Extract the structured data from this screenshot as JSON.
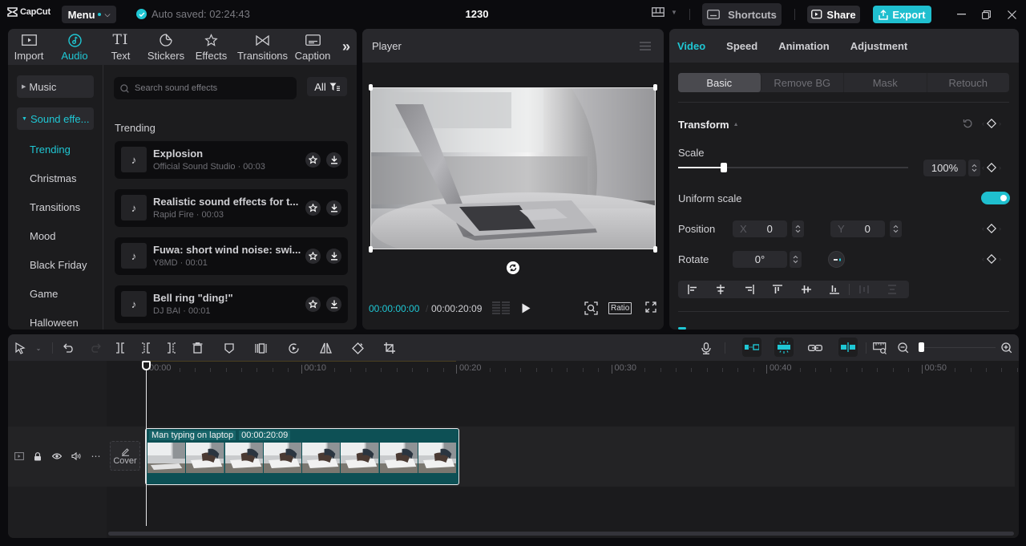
{
  "app": {
    "brand": "CapCut",
    "menu_label": "Menu",
    "autosave_text": "Auto saved: 02:24:43",
    "project_title": "1230",
    "shortcuts_label": "Shortcuts",
    "share_label": "Share",
    "export_label": "Export",
    "accent_color": "#1fc7d4"
  },
  "media": {
    "tabs": [
      {
        "label": "Import",
        "icon": "import-icon",
        "active": false
      },
      {
        "label": "Audio",
        "icon": "audio-icon",
        "active": true
      },
      {
        "label": "Text",
        "icon": "text-icon",
        "active": false
      },
      {
        "label": "Stickers",
        "icon": "stickers-icon",
        "active": false
      },
      {
        "label": "Effects",
        "icon": "effects-icon",
        "active": false
      },
      {
        "label": "Transitions",
        "icon": "transitions-icon",
        "active": false
      },
      {
        "label": "Caption",
        "icon": "caption-icon",
        "active": false
      }
    ],
    "categories": [
      {
        "label": "Music",
        "open": false
      },
      {
        "label": "Sound effe...",
        "open": true
      }
    ],
    "subcategories": [
      {
        "label": "Trending",
        "active": true
      },
      {
        "label": "Christmas",
        "active": false
      },
      {
        "label": "Transitions",
        "active": false
      },
      {
        "label": "Mood",
        "active": false
      },
      {
        "label": "Black Friday",
        "active": false
      },
      {
        "label": "Game",
        "active": false
      },
      {
        "label": "Halloween",
        "active": false
      }
    ],
    "search_placeholder": "Search sound effects",
    "filter_label": "All",
    "section_title": "Trending",
    "items": [
      {
        "title": "Explosion",
        "subtitle": "Official Sound Studio · 00:03"
      },
      {
        "title": "Realistic sound effects for t...",
        "subtitle": "Rapid Fire · 00:03"
      },
      {
        "title": "Fuwa: short wind noise: swi...",
        "subtitle": "Y8MD · 00:01"
      },
      {
        "title": "Bell ring \"ding!\"",
        "subtitle": "DJ BAI · 00:01"
      }
    ]
  },
  "player": {
    "title": "Player",
    "current_time": "00:00:00:00",
    "separator": "/",
    "total_time": "00:00:20:09",
    "ratio_label": "Ratio"
  },
  "properties": {
    "tabs": [
      {
        "label": "Video",
        "active": true
      },
      {
        "label": "Speed",
        "active": false
      },
      {
        "label": "Animation",
        "active": false
      },
      {
        "label": "Adjustment",
        "active": false
      }
    ],
    "subtabs": [
      {
        "label": "Basic",
        "active": true
      },
      {
        "label": "Remove BG",
        "active": false
      },
      {
        "label": "Mask",
        "active": false
      },
      {
        "label": "Retouch",
        "active": false
      }
    ],
    "transform_label": "Transform",
    "scale_label": "Scale",
    "scale_value": "100%",
    "scale_slider_fraction": 0.2,
    "uniform_scale_label": "Uniform scale",
    "uniform_scale_on": true,
    "position_label": "Position",
    "position_x_label": "X",
    "position_x": "0",
    "position_y_label": "Y",
    "position_y": "0",
    "rotate_label": "Rotate",
    "rotate_value": "0°"
  },
  "timeline": {
    "ruler_labels": [
      "00:00",
      "00:10",
      "00:20",
      "00:30",
      "00:40",
      "00:50"
    ],
    "cover_label": "Cover",
    "clip": {
      "name": "Man typing on laptop",
      "duration": "00:00:20:09"
    }
  }
}
